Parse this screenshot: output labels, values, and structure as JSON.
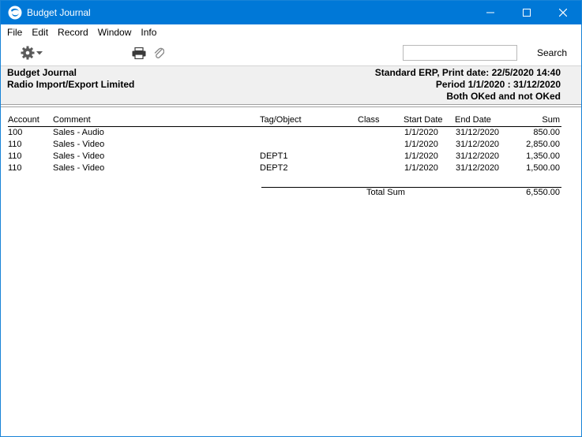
{
  "window": {
    "title": "Budget Journal"
  },
  "menu": [
    "File",
    "Edit",
    "Record",
    "Window",
    "Info"
  ],
  "toolbar": {
    "search_value": "",
    "search_label": "Search"
  },
  "header": {
    "left_line1": "Budget Journal",
    "left_line2": "Radio Import/Export Limited",
    "right_line1": "Standard ERP, Print date: 22/5/2020 14:40",
    "right_line2": "Period  1/1/2020 : 31/12/2020",
    "right_line3": "Both OKed and not OKed"
  },
  "report": {
    "columns": [
      "Account",
      "Comment",
      "Tag/Object",
      "Class",
      "Start Date",
      "End Date",
      "Sum"
    ],
    "rows": [
      [
        "100",
        "Sales - Audio",
        "",
        "",
        "1/1/2020",
        "31/12/2020",
        "850.00"
      ],
      [
        "110",
        "Sales - Video",
        "",
        "",
        "1/1/2020",
        "31/12/2020",
        "2,850.00"
      ],
      [
        "110",
        "Sales - Video",
        "DEPT1",
        "",
        "1/1/2020",
        "31/12/2020",
        "1,350.00"
      ],
      [
        "110",
        "Sales - Video",
        "DEPT2",
        "",
        "1/1/2020",
        "31/12/2020",
        "1,500.00"
      ]
    ],
    "total_label": "Total Sum",
    "total_value": "6,550.00"
  },
  "colors": {
    "titlebar": "#0078d7",
    "header_panel": "#f0f0f0",
    "icon_gray": "#5a5a5a"
  },
  "icons": [
    "app-icon",
    "minimize-icon",
    "maximize-icon",
    "close-icon",
    "gear-icon",
    "chevron-down-icon",
    "printer-icon",
    "paperclip-icon"
  ]
}
